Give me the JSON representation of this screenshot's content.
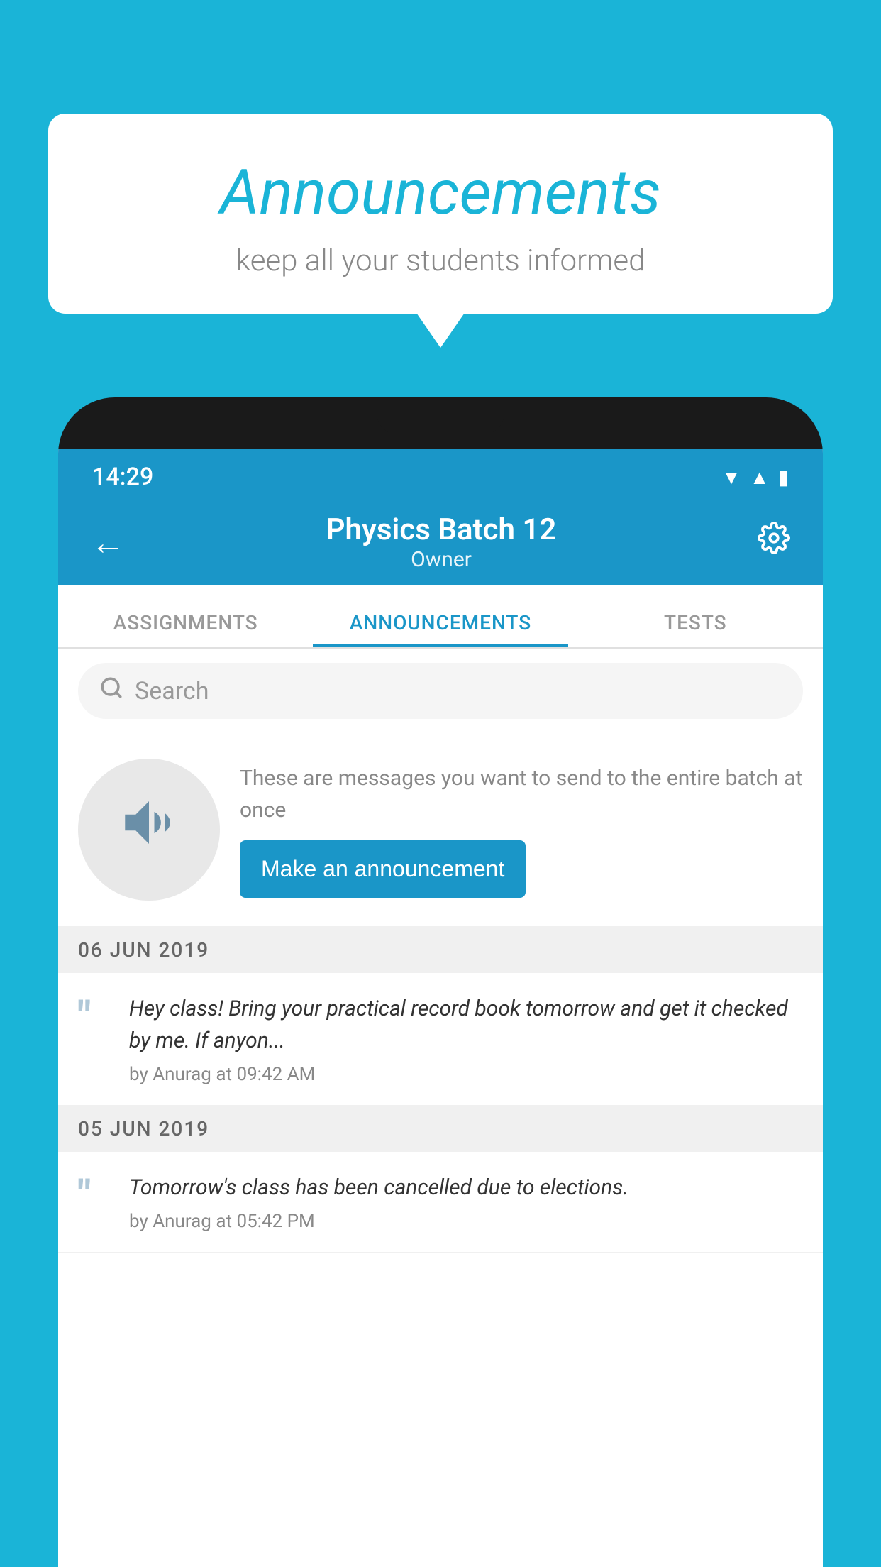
{
  "background_color": "#1ab4d7",
  "speech_bubble": {
    "title": "Announcements",
    "subtitle": "keep all your students informed"
  },
  "phone": {
    "status_bar": {
      "time": "14:29"
    },
    "app_bar": {
      "title": "Physics Batch 12",
      "subtitle": "Owner",
      "back_label": "←",
      "settings_label": "⚙"
    },
    "tabs": [
      {
        "label": "ASSIGNMENTS",
        "active": false
      },
      {
        "label": "ANNOUNCEMENTS",
        "active": true
      },
      {
        "label": "TESTS",
        "active": false
      }
    ],
    "search": {
      "placeholder": "Search"
    },
    "announcement_prompt": {
      "description": "These are messages you want to send to the entire batch at once",
      "button_label": "Make an announcement"
    },
    "announcements": [
      {
        "date": "06  JUN  2019",
        "text": "Hey class! Bring your practical record book tomorrow and get it checked by me. If anyon...",
        "author": "by Anurag at 09:42 AM"
      },
      {
        "date": "05  JUN  2019",
        "text": "Tomorrow's class has been cancelled due to elections.",
        "author": "by Anurag at 05:42 PM"
      }
    ]
  }
}
